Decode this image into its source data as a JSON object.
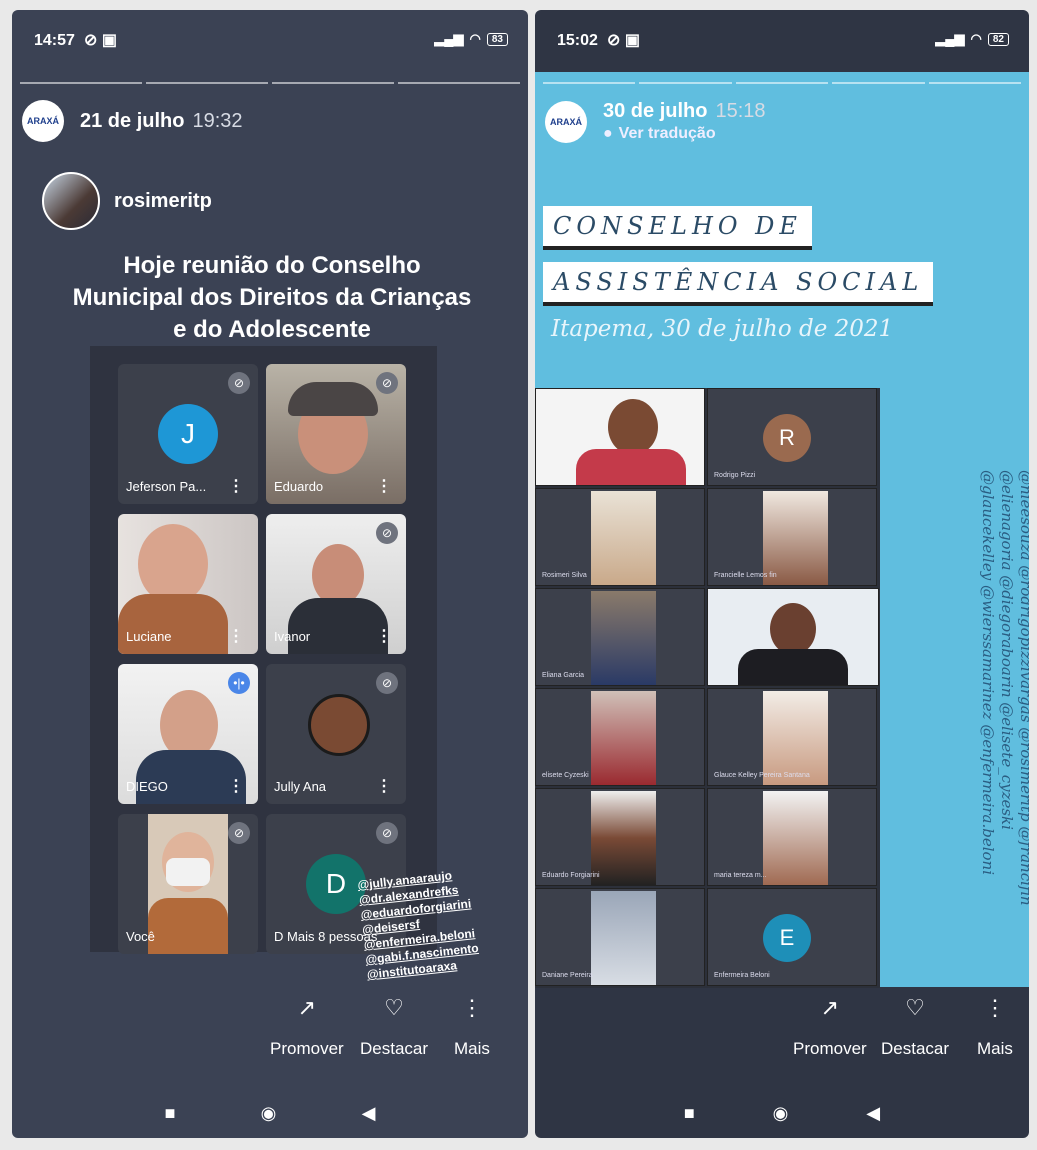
{
  "left": {
    "status": {
      "time": "14:57",
      "battery": "83"
    },
    "story": {
      "account_logo": "ARAXÁ",
      "date": "21 de julho",
      "time": "19:32"
    },
    "repost": {
      "user": "rosimeritp"
    },
    "headline": "Hoje reunião do Conselho Municipal dos Direitos da Crianças e do Adolescente",
    "participants": [
      {
        "name": "Jeferson Pa...",
        "initial": "J",
        "color": "#1e97d6"
      },
      {
        "name": "Eduardo"
      },
      {
        "name": "Luciane"
      },
      {
        "name": "Ivanor"
      },
      {
        "name": "DIEGO"
      },
      {
        "name": "Jully Ana"
      },
      {
        "name": "Você"
      },
      {
        "name": "D",
        "initial": "D",
        "color": "#12736a",
        "extra": "Mais 8 pessoas"
      }
    ],
    "tags": [
      "@jully.anaaraujo",
      "@dr.alexandrefks",
      "@eduardoforgiarini",
      "@deisersf",
      "@enfermeira.beloni",
      "@gabi.f.nascimento",
      "@institutoaraxa"
    ],
    "actions": {
      "promote": "Promover",
      "highlight": "Destacar",
      "more": "Mais"
    }
  },
  "right": {
    "status": {
      "time": "15:02",
      "battery": "82"
    },
    "story": {
      "account_logo": "ARAXÁ",
      "date": "30 de julho",
      "time": "15:18",
      "translate": "Ver tradução"
    },
    "council": {
      "line1": "CONSELHO DE",
      "line2": "ASSISTÊNCIA SOCIAL"
    },
    "place_date": "Itapema, 30 de julho de 2021",
    "participants": [
      {
        "name": ""
      },
      {
        "name": "Rodrigo Pizzi",
        "initial": "R",
        "color": "#9a6a4f"
      },
      {
        "name": "Rosimeri Silva"
      },
      {
        "name": "Francielle Lemos fin"
      },
      {
        "name": "Eliana Garcia"
      },
      {
        "name": ""
      },
      {
        "name": "elisete Cyzeski"
      },
      {
        "name": "Glauce Kelley Pereira Santana"
      },
      {
        "name": "Eduardo Forgiarini"
      },
      {
        "name": "maria tereza m..."
      },
      {
        "name": "Daniane Pereira"
      },
      {
        "name": "Enfermeira Beloni",
        "initial": "E",
        "color": "#1e8fb8"
      }
    ],
    "tags": [
      "@nieesouza @rodrigopizzivargas @rosimeritp @francifin",
      "@elienagoria @diegoraboarin @elisete_cyzeski",
      "@glaucekelley @wierssamarinez @enfermeira.beloni"
    ],
    "actions": {
      "promote": "Promover",
      "highlight": "Destacar",
      "more": "Mais"
    }
  },
  "icons": [
    "mute-icon",
    "promote-icon",
    "highlight-icon",
    "more-icon",
    "recents-icon",
    "home-icon",
    "back-icon"
  ]
}
